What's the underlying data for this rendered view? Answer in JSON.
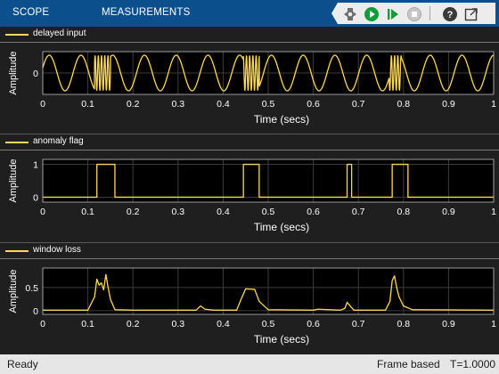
{
  "toolbar": {
    "tabs": [
      "SCOPE",
      "MEASUREMENTS"
    ],
    "tools": [
      "highlight-simulink-block-icon",
      "run-icon",
      "step-forward-icon",
      "stop-icon",
      "help-icon",
      "undock-icon"
    ]
  },
  "colors": {
    "trace": "#ffd85a",
    "axes_bg": "#000000",
    "grid": "#3c3c3c",
    "figure_bg": "#1f1f1f",
    "toolbar": "#0b4f8c"
  },
  "legends": [
    "delayed input",
    "anomaly flag",
    "window loss"
  ],
  "chart_data": [
    {
      "type": "line",
      "series": [
        {
          "name": "delayed input",
          "description": "sinusoid with bursts of high-frequency oscillation near t=0.12, 0.45, 0.78"
        }
      ],
      "ylabel": "Amplitude",
      "xlabel": "Time (secs)",
      "xlim": [
        0,
        1
      ],
      "ylim": [
        -1.2,
        1.2
      ],
      "xticks": [
        "0",
        "0.1",
        "0.2",
        "0.3",
        "0.4",
        "0.5",
        "0.6",
        "0.7",
        "0.8",
        "0.9",
        "1"
      ],
      "yticks": [
        "0"
      ],
      "grid": true
    },
    {
      "type": "line",
      "series": [
        {
          "name": "anomaly flag",
          "x": [
            0,
            0.12,
            0.12,
            0.16,
            0.16,
            0.445,
            0.445,
            0.48,
            0.48,
            0.675,
            0.675,
            0.685,
            0.685,
            0.775,
            0.775,
            0.81,
            0.81,
            1
          ],
          "y": [
            0,
            0,
            1,
            1,
            0,
            0,
            1,
            1,
            0,
            0,
            1,
            1,
            0,
            0,
            1,
            1,
            0,
            0
          ]
        }
      ],
      "ylabel": "Amplitude",
      "xlabel": "Time (secs)",
      "xlim": [
        0,
        1
      ],
      "ylim": [
        -0.15,
        1.15
      ],
      "xticks": [
        "0",
        "0.1",
        "0.2",
        "0.3",
        "0.4",
        "0.5",
        "0.6",
        "0.7",
        "0.8",
        "0.9",
        "1"
      ],
      "yticks": [
        "0",
        "1"
      ],
      "grid": true
    },
    {
      "type": "line",
      "series": [
        {
          "name": "window loss",
          "x": [
            0,
            0.1,
            0.115,
            0.12,
            0.125,
            0.13,
            0.135,
            0.14,
            0.145,
            0.15,
            0.16,
            0.2,
            0.34,
            0.35,
            0.36,
            0.38,
            0.43,
            0.44,
            0.45,
            0.47,
            0.48,
            0.5,
            0.6,
            0.61,
            0.66,
            0.67,
            0.675,
            0.68,
            0.69,
            0.76,
            0.77,
            0.775,
            0.78,
            0.785,
            0.79,
            0.8,
            0.82,
            1
          ],
          "y": [
            0.01,
            0.01,
            0.3,
            0.68,
            0.55,
            0.6,
            0.45,
            0.78,
            0.5,
            0.25,
            0.02,
            0.01,
            0.01,
            0.1,
            0.03,
            0.01,
            0.01,
            0.25,
            0.47,
            0.46,
            0.2,
            0.02,
            0.01,
            0.03,
            0.01,
            0.05,
            0.18,
            0.12,
            0.01,
            0.01,
            0.2,
            0.65,
            0.75,
            0.5,
            0.3,
            0.1,
            0.02,
            0.01
          ]
        }
      ],
      "ylabel": "Amplitude",
      "xlabel": "Time (secs)",
      "xlim": [
        0,
        1
      ],
      "ylim": [
        -0.08,
        0.92
      ],
      "xticks": [
        "0",
        "0.1",
        "0.2",
        "0.3",
        "0.4",
        "0.5",
        "0.6",
        "0.7",
        "0.8",
        "0.9",
        "1"
      ],
      "yticks": [
        "0",
        "0.5"
      ],
      "grid": true
    }
  ],
  "status": {
    "ready": "Ready",
    "mode": "Frame based",
    "time": "T=1.0000"
  }
}
